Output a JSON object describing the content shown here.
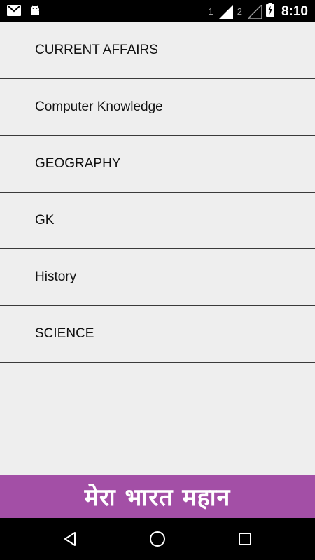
{
  "status_bar": {
    "sim1": "1",
    "sim2": "2",
    "time": "8:10",
    "icons": [
      "gmail-icon",
      "android-debug-icon",
      "signal-icon",
      "signal-icon",
      "battery-charging-icon"
    ]
  },
  "categories": [
    {
      "label": "CURRENT AFFAIRS"
    },
    {
      "label": "Computer Knowledge"
    },
    {
      "label": "GEOGRAPHY"
    },
    {
      "label": "GK"
    },
    {
      "label": "History"
    },
    {
      "label": "SCIENCE"
    }
  ],
  "banner": {
    "text": "मेरा भारत महान",
    "color": "#a34fa6"
  },
  "nav_bar": {
    "icons": [
      "back-icon",
      "home-icon",
      "recents-icon"
    ]
  }
}
